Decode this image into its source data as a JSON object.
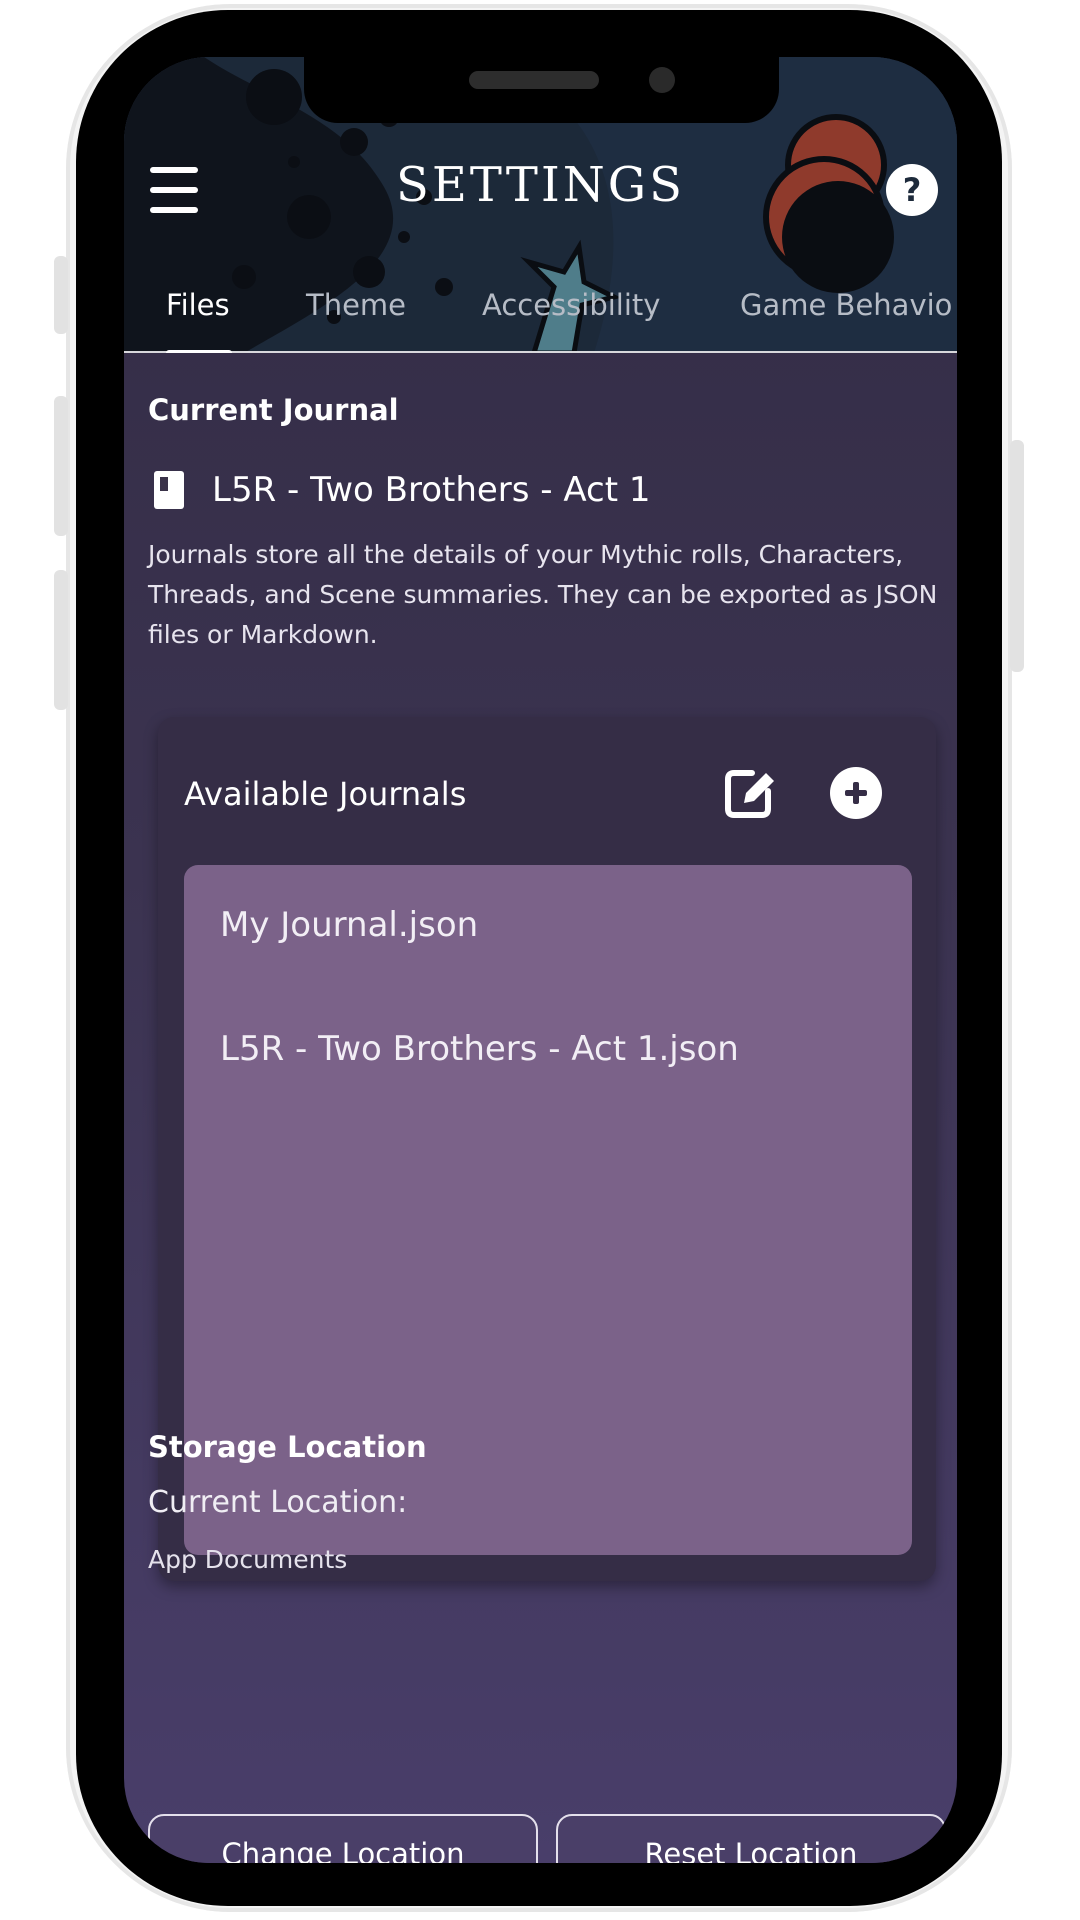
{
  "header": {
    "title": "SETTINGS",
    "menu_icon": "hamburger-menu-icon",
    "help_label": "?",
    "tabs": [
      {
        "label": "Files",
        "active": true
      },
      {
        "label": "Theme",
        "active": false
      },
      {
        "label": "Accessibility",
        "active": false
      },
      {
        "label": "Game Behavio",
        "active": false
      }
    ]
  },
  "current_journal": {
    "heading": "Current Journal",
    "icon": "book-icon",
    "name": "L5R - Two Brothers - Act 1",
    "description": "Journals store all the details of your Mythic rolls, Characters, Threads, and Scene summaries. They can be exported as JSON files or Markdown."
  },
  "available_journals": {
    "heading": "Available Journals",
    "edit_icon": "edit-icon",
    "add_icon": "add-circle-icon",
    "items": [
      "My Journal.json",
      "L5R - Two Brothers - Act 1.json"
    ]
  },
  "storage": {
    "heading": "Storage Location",
    "current_label": "Current Location:",
    "current_value": "App Documents",
    "change_label": "Change Location",
    "reset_label": "Reset Location"
  },
  "colors": {
    "header_bg": "#1d2a3b",
    "card_bg": "#352d46",
    "list_bg": "#7b6289",
    "accent_red": "#8f3a2c"
  }
}
